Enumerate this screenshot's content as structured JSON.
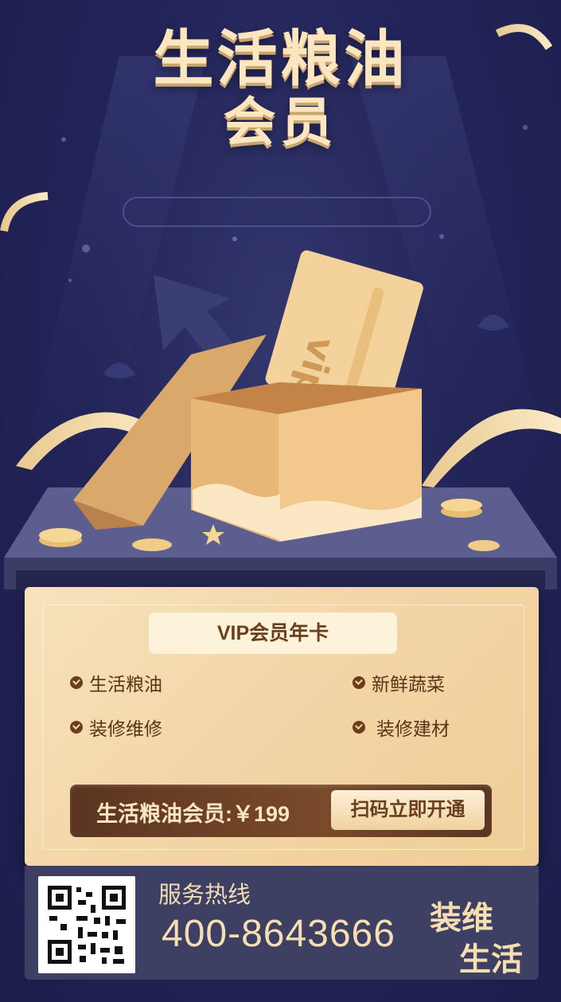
{
  "header": {
    "title_line1": "生活粮油",
    "title_line2": "会员"
  },
  "box": {
    "card_text": "vip"
  },
  "card": {
    "tag": "VIP会员年卡",
    "features": [
      "生活粮油",
      "新鲜蔬菜",
      "装修维修",
      "装修建材"
    ],
    "price_label": "生活粮油会员:￥199",
    "cta_label": "扫码立即开通"
  },
  "footer": {
    "hotline_label": "服务热线",
    "hotline_number": "400-8643666",
    "slogan_line1": "装维",
    "slogan_line2": "生活"
  },
  "colors": {
    "background": "#23255a",
    "gold": "#f3d6a8",
    "brown": "#6b3f1d"
  }
}
